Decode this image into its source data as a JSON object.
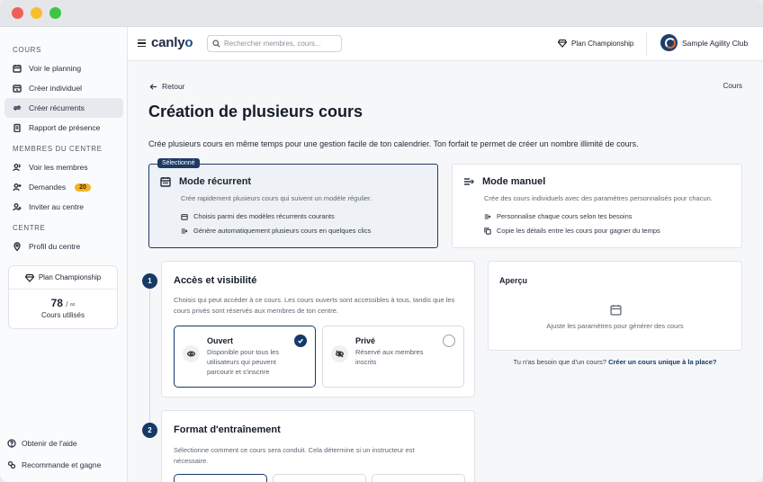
{
  "topbar": {
    "logo_prefix": "canly",
    "logo_suffix": "o",
    "search_placeholder": "Rechercher membres, cours...",
    "plan": "Plan Championship",
    "club": "Sample Agility Club"
  },
  "sidebar": {
    "sections": [
      {
        "title": "COURS",
        "items": [
          {
            "label": "Voir le planning",
            "icon": "calendar-icon"
          },
          {
            "label": "Créer individuel",
            "icon": "calendar-plus-icon"
          },
          {
            "label": "Créer récurrents",
            "icon": "repeat-icon",
            "active": true
          },
          {
            "label": "Rapport de présence",
            "icon": "clipboard-icon"
          }
        ]
      },
      {
        "title": "MEMBRES DU CENTRE",
        "items": [
          {
            "label": "Voir les membres",
            "icon": "users-icon"
          },
          {
            "label": "Demandes",
            "icon": "user-plus-icon",
            "badge": "20"
          },
          {
            "label": "Inviter au centre",
            "icon": "user-add-icon"
          }
        ]
      },
      {
        "title": "CENTRE",
        "items": [
          {
            "label": "Profil du centre",
            "icon": "location-pin-icon"
          }
        ]
      }
    ],
    "plan_card": {
      "name": "Plan Championship",
      "used": "78",
      "limit": "∞",
      "label": "Cours utilisés"
    },
    "help": "Obtenir de l'aide",
    "refer": "Recommande et gagne"
  },
  "main": {
    "back": "Retour",
    "breadcrumb": "Cours",
    "title": "Création de plusieurs cours",
    "intro": "Crée plusieurs cours en même temps pour une gestion facile de ton calendrier. Ton forfait te permet de créer un nombre illimité de cours.",
    "modes": [
      {
        "badge": "Sélectionné",
        "title": "Mode récurrent",
        "desc": "Crée rapidement plusieurs cours qui suivent un modèle régulier.",
        "features": [
          "Choisis parmi des modèles récurrents courants",
          "Génère automatiquement plusieurs cours en quelques clics"
        ]
      },
      {
        "title": "Mode manuel",
        "desc": "Crée des cours individuels avec des paramètres personnalisés pour chacun.",
        "features": [
          "Personnalise chaque cours selon tes besoins",
          "Copie les détails entre les cours pour gagner du temps"
        ]
      }
    ],
    "step1": {
      "num": "1",
      "title": "Accès et visibilité",
      "desc": "Choisis qui peut accéder à ce cours. Les cours ouverts sont accessibles à tous, tandis que les cours privés sont réservés aux membres de ton centre.",
      "options": [
        {
          "title": "Ouvert",
          "desc": "Disponible pour tous les utilisateurs qui peuvent parcourir et s'inscrire",
          "selected": true
        },
        {
          "title": "Privé",
          "desc": "Réservé aux membres inscrits",
          "selected": false
        }
      ]
    },
    "step2": {
      "num": "2",
      "title": "Format d'entraînement",
      "desc": "Sélectionne comment ce cours sera conduit. Cela détermine si un instructeur est nécessaire."
    },
    "preview": {
      "title": "Aperçu",
      "text": "Ajuste les paramètres pour générer des cours"
    },
    "help_text": "Tu n'as besoin que d'un cours?",
    "help_link": "Créer un cours unique à la place?"
  }
}
